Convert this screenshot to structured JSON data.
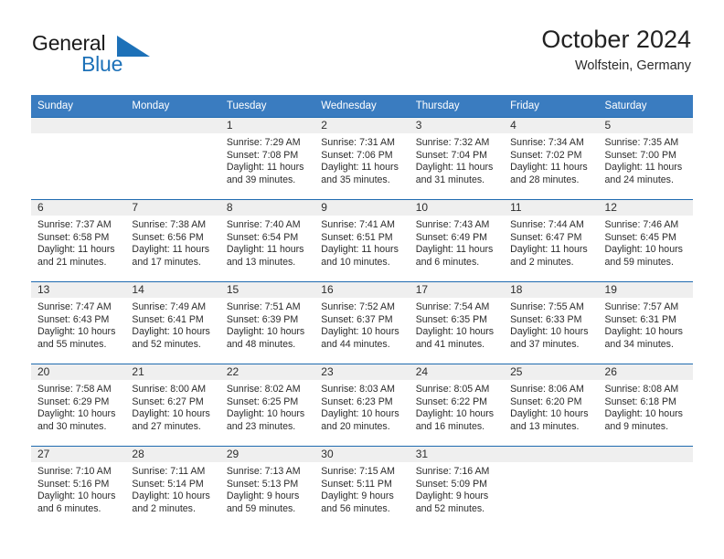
{
  "brand": {
    "word1": "General",
    "word2": "Blue",
    "logo_color": "#1d71b8",
    "triangle_icon": "triangle-right-icon"
  },
  "header": {
    "title": "October 2024",
    "subtitle": "Wolfstein, Germany"
  },
  "theme": {
    "header_blue": "#3a7cc0",
    "separator_blue": "#1f6bb0",
    "daynum_band": "#efefef",
    "text": "#2b2b2b"
  },
  "weekdays": [
    "Sunday",
    "Monday",
    "Tuesday",
    "Wednesday",
    "Thursday",
    "Friday",
    "Saturday"
  ],
  "labels": {
    "sunrise": "Sunrise:",
    "sunset": "Sunset:",
    "daylight": "Daylight:"
  },
  "weeks": [
    [
      {
        "day": "",
        "lines": []
      },
      {
        "day": "",
        "lines": []
      },
      {
        "day": "1",
        "lines": [
          "Sunrise: 7:29 AM",
          "Sunset: 7:08 PM",
          "Daylight: 11 hours",
          "and 39 minutes."
        ]
      },
      {
        "day": "2",
        "lines": [
          "Sunrise: 7:31 AM",
          "Sunset: 7:06 PM",
          "Daylight: 11 hours",
          "and 35 minutes."
        ]
      },
      {
        "day": "3",
        "lines": [
          "Sunrise: 7:32 AM",
          "Sunset: 7:04 PM",
          "Daylight: 11 hours",
          "and 31 minutes."
        ]
      },
      {
        "day": "4",
        "lines": [
          "Sunrise: 7:34 AM",
          "Sunset: 7:02 PM",
          "Daylight: 11 hours",
          "and 28 minutes."
        ]
      },
      {
        "day": "5",
        "lines": [
          "Sunrise: 7:35 AM",
          "Sunset: 7:00 PM",
          "Daylight: 11 hours",
          "and 24 minutes."
        ]
      }
    ],
    [
      {
        "day": "6",
        "lines": [
          "Sunrise: 7:37 AM",
          "Sunset: 6:58 PM",
          "Daylight: 11 hours",
          "and 21 minutes."
        ]
      },
      {
        "day": "7",
        "lines": [
          "Sunrise: 7:38 AM",
          "Sunset: 6:56 PM",
          "Daylight: 11 hours",
          "and 17 minutes."
        ]
      },
      {
        "day": "8",
        "lines": [
          "Sunrise: 7:40 AM",
          "Sunset: 6:54 PM",
          "Daylight: 11 hours",
          "and 13 minutes."
        ]
      },
      {
        "day": "9",
        "lines": [
          "Sunrise: 7:41 AM",
          "Sunset: 6:51 PM",
          "Daylight: 11 hours",
          "and 10 minutes."
        ]
      },
      {
        "day": "10",
        "lines": [
          "Sunrise: 7:43 AM",
          "Sunset: 6:49 PM",
          "Daylight: 11 hours",
          "and 6 minutes."
        ]
      },
      {
        "day": "11",
        "lines": [
          "Sunrise: 7:44 AM",
          "Sunset: 6:47 PM",
          "Daylight: 11 hours",
          "and 2 minutes."
        ]
      },
      {
        "day": "12",
        "lines": [
          "Sunrise: 7:46 AM",
          "Sunset: 6:45 PM",
          "Daylight: 10 hours",
          "and 59 minutes."
        ]
      }
    ],
    [
      {
        "day": "13",
        "lines": [
          "Sunrise: 7:47 AM",
          "Sunset: 6:43 PM",
          "Daylight: 10 hours",
          "and 55 minutes."
        ]
      },
      {
        "day": "14",
        "lines": [
          "Sunrise: 7:49 AM",
          "Sunset: 6:41 PM",
          "Daylight: 10 hours",
          "and 52 minutes."
        ]
      },
      {
        "day": "15",
        "lines": [
          "Sunrise: 7:51 AM",
          "Sunset: 6:39 PM",
          "Daylight: 10 hours",
          "and 48 minutes."
        ]
      },
      {
        "day": "16",
        "lines": [
          "Sunrise: 7:52 AM",
          "Sunset: 6:37 PM",
          "Daylight: 10 hours",
          "and 44 minutes."
        ]
      },
      {
        "day": "17",
        "lines": [
          "Sunrise: 7:54 AM",
          "Sunset: 6:35 PM",
          "Daylight: 10 hours",
          "and 41 minutes."
        ]
      },
      {
        "day": "18",
        "lines": [
          "Sunrise: 7:55 AM",
          "Sunset: 6:33 PM",
          "Daylight: 10 hours",
          "and 37 minutes."
        ]
      },
      {
        "day": "19",
        "lines": [
          "Sunrise: 7:57 AM",
          "Sunset: 6:31 PM",
          "Daylight: 10 hours",
          "and 34 minutes."
        ]
      }
    ],
    [
      {
        "day": "20",
        "lines": [
          "Sunrise: 7:58 AM",
          "Sunset: 6:29 PM",
          "Daylight: 10 hours",
          "and 30 minutes."
        ]
      },
      {
        "day": "21",
        "lines": [
          "Sunrise: 8:00 AM",
          "Sunset: 6:27 PM",
          "Daylight: 10 hours",
          "and 27 minutes."
        ]
      },
      {
        "day": "22",
        "lines": [
          "Sunrise: 8:02 AM",
          "Sunset: 6:25 PM",
          "Daylight: 10 hours",
          "and 23 minutes."
        ]
      },
      {
        "day": "23",
        "lines": [
          "Sunrise: 8:03 AM",
          "Sunset: 6:23 PM",
          "Daylight: 10 hours",
          "and 20 minutes."
        ]
      },
      {
        "day": "24",
        "lines": [
          "Sunrise: 8:05 AM",
          "Sunset: 6:22 PM",
          "Daylight: 10 hours",
          "and 16 minutes."
        ]
      },
      {
        "day": "25",
        "lines": [
          "Sunrise: 8:06 AM",
          "Sunset: 6:20 PM",
          "Daylight: 10 hours",
          "and 13 minutes."
        ]
      },
      {
        "day": "26",
        "lines": [
          "Sunrise: 8:08 AM",
          "Sunset: 6:18 PM",
          "Daylight: 10 hours",
          "and 9 minutes."
        ]
      }
    ],
    [
      {
        "day": "27",
        "lines": [
          "Sunrise: 7:10 AM",
          "Sunset: 5:16 PM",
          "Daylight: 10 hours",
          "and 6 minutes."
        ]
      },
      {
        "day": "28",
        "lines": [
          "Sunrise: 7:11 AM",
          "Sunset: 5:14 PM",
          "Daylight: 10 hours",
          "and 2 minutes."
        ]
      },
      {
        "day": "29",
        "lines": [
          "Sunrise: 7:13 AM",
          "Sunset: 5:13 PM",
          "Daylight: 9 hours",
          "and 59 minutes."
        ]
      },
      {
        "day": "30",
        "lines": [
          "Sunrise: 7:15 AM",
          "Sunset: 5:11 PM",
          "Daylight: 9 hours",
          "and 56 minutes."
        ]
      },
      {
        "day": "31",
        "lines": [
          "Sunrise: 7:16 AM",
          "Sunset: 5:09 PM",
          "Daylight: 9 hours",
          "and 52 minutes."
        ]
      },
      {
        "day": "",
        "lines": []
      },
      {
        "day": "",
        "lines": []
      }
    ]
  ]
}
